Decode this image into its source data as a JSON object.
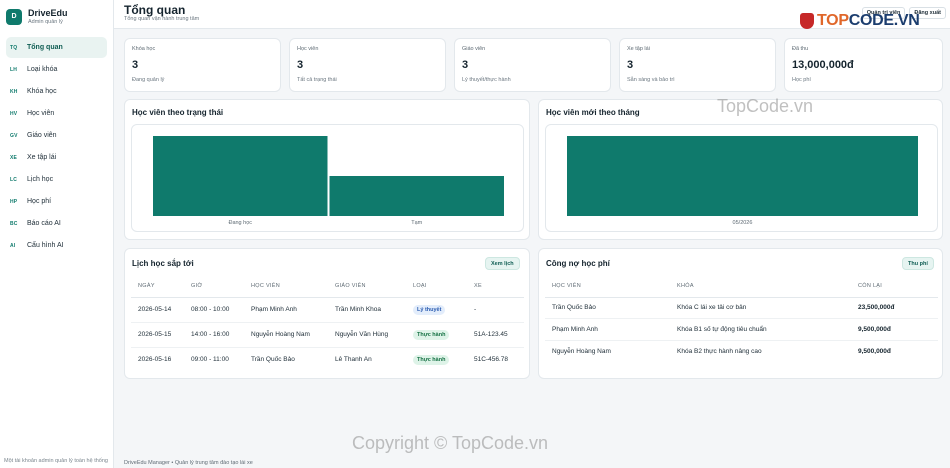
{
  "brand": {
    "logo_letter": "D",
    "name": "DriveEdu",
    "subtitle": "Admin quản lý"
  },
  "sidebar": {
    "items": [
      {
        "code": "TQ",
        "label": "Tổng quan",
        "active": true
      },
      {
        "code": "LH",
        "label": "Loại khóa"
      },
      {
        "code": "KH",
        "label": "Khóa học"
      },
      {
        "code": "HV",
        "label": "Học viên"
      },
      {
        "code": "GV",
        "label": "Giáo viên"
      },
      {
        "code": "XE",
        "label": "Xe tập lái"
      },
      {
        "code": "LC",
        "label": "Lịch học"
      },
      {
        "code": "HP",
        "label": "Học phí"
      },
      {
        "code": "BC",
        "label": "Báo cáo AI"
      },
      {
        "code": "AI",
        "label": "Cấu hình AI"
      }
    ],
    "footer": "Một tài khoản admin quản lý toàn hệ thống"
  },
  "header": {
    "title": "Tổng quan",
    "subtitle": "Tổng quan vận hành trung tâm",
    "role_button": "Quản trị viên",
    "logout_button": "Đăng xuất"
  },
  "stats": [
    {
      "label": "Khóa học",
      "value": "3",
      "hint": "Đang quản lý"
    },
    {
      "label": "Học viên",
      "value": "3",
      "hint": "Tất cả trạng thái"
    },
    {
      "label": "Giáo viên",
      "value": "3",
      "hint": "Lý thuyết/thực hành"
    },
    {
      "label": "Xe tập lái",
      "value": "3",
      "hint": "Sẵn sàng và bảo trì"
    },
    {
      "label": "Đã thu",
      "value": "13,000,000đ",
      "hint": "Học phí"
    }
  ],
  "status_chart": {
    "title": "Học viên theo trạng thái",
    "chart_data": {
      "type": "bar",
      "categories": [
        "Đang học",
        "Tạm"
      ],
      "values": [
        2,
        1
      ],
      "ylim": [
        0,
        2
      ],
      "color": "#0f7a6c"
    }
  },
  "monthly_chart": {
    "title": "Học viên mới theo tháng",
    "chart_data": {
      "type": "bar",
      "categories": [
        "05/2026"
      ],
      "values": [
        3
      ],
      "ylim": [
        0,
        3
      ],
      "color": "#0f7a6c"
    }
  },
  "schedule": {
    "title": "Lịch học sắp tới",
    "button": "Xem lịch",
    "columns": [
      "NGÀY",
      "GIỜ",
      "HỌC VIÊN",
      "GIÁO VIÊN",
      "LOẠI",
      "XE"
    ],
    "rows": [
      {
        "date": "2026-05-14",
        "time": "08:00 - 10:00",
        "student": "Phạm Minh Anh",
        "teacher": "Trần Minh Khoa",
        "type": "Lý thuyết",
        "car": "-"
      },
      {
        "date": "2026-05-15",
        "time": "14:00 - 16:00",
        "student": "Nguyễn Hoàng Nam",
        "teacher": "Nguyễn Văn Hùng",
        "type": "Thực hành",
        "car": "51A-123.45"
      },
      {
        "date": "2026-05-16",
        "time": "09:00 - 11:00",
        "student": "Trần Quốc Bảo",
        "teacher": "Lê Thanh An",
        "type": "Thực hành",
        "car": "51C-456.78"
      }
    ]
  },
  "debts": {
    "title": "Công nợ học phí",
    "button": "Thu phí",
    "columns": [
      "HỌC VIÊN",
      "KHÓA",
      "CÒN LẠI"
    ],
    "rows": [
      {
        "student": "Trần Quốc Bảo",
        "course": "Khóa C lái xe tải cơ bản",
        "remaining": "23,500,000đ"
      },
      {
        "student": "Phạm Minh Anh",
        "course": "Khóa B1 số tự động tiêu chuẩn",
        "remaining": "9,500,000đ"
      },
      {
        "student": "Nguyễn Hoàng Nam",
        "course": "Khóa B2 thực hành nâng cao",
        "remaining": "9,500,000đ"
      }
    ]
  },
  "footer": "DriveEdu Manager • Quản lý trung tâm đào tạo lái xe",
  "watermark": {
    "logo_prefix": "TOP",
    "logo_suffix": "CODE.VN",
    "mid": "TopCode.vn",
    "bottom": "Copyright © TopCode.vn"
  }
}
